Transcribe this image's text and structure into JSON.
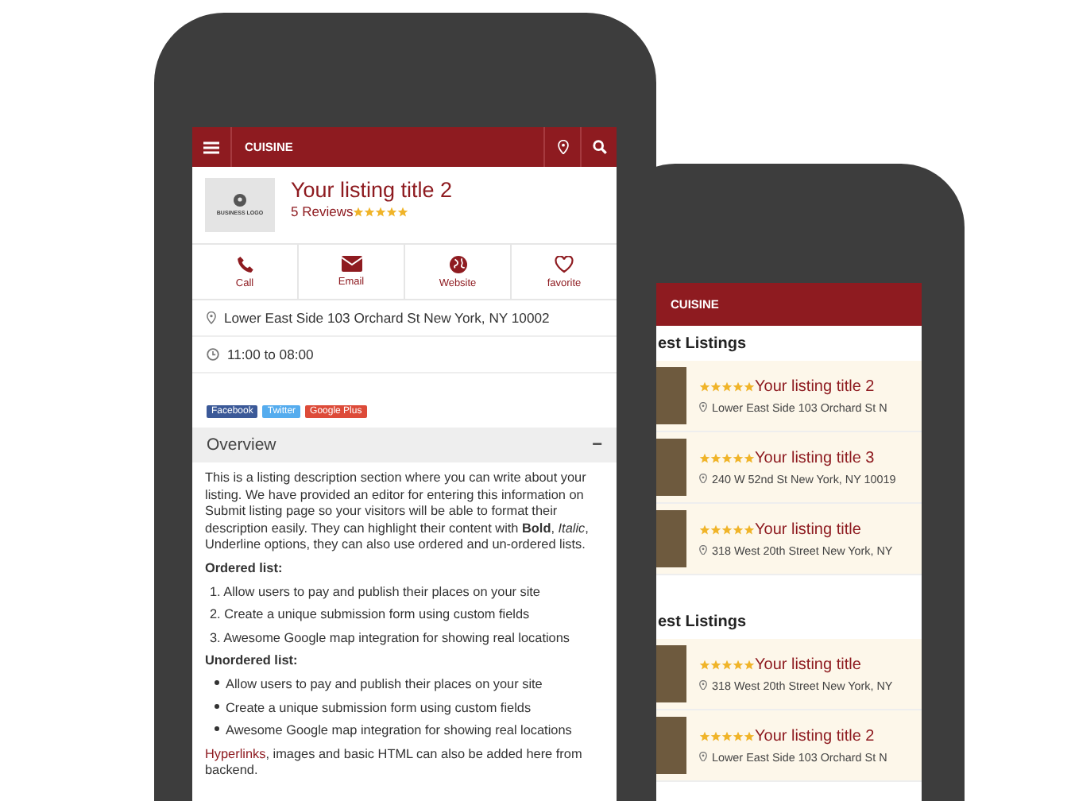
{
  "front_phone": {
    "header": {
      "title": "CUISINE"
    },
    "listing": {
      "logo_text": "BUSINESS LOGO",
      "title": "Your listing title 2",
      "reviews": "5 Reviews",
      "stars": 5
    },
    "actions": [
      {
        "kind": "phone",
        "label": "Call"
      },
      {
        "kind": "mail",
        "label": "Email"
      },
      {
        "kind": "globe",
        "label": "Website"
      },
      {
        "kind": "heart",
        "label": "favorite"
      }
    ],
    "address": "Lower East Side 103 Orchard St New York, NY 10002",
    "hours": "11:00 to 08:00",
    "share": [
      {
        "label": "Facebook",
        "color": "#3b5998"
      },
      {
        "label": "Twitter",
        "color": "#55acee"
      },
      {
        "label": "Google Plus",
        "color": "#dd4b39"
      }
    ],
    "overview": {
      "title": "Overview",
      "toggle": "−",
      "intro": "This is a listing description section where you can write about your listing. We have provided an editor for entering this information on Submit listing page so your visitors will be able to format their description easily. They can highlight their content with **Bold**, *Italic*, Underline options, they can also use ordered and un-ordered lists.",
      "ordered_heading": "Ordered list:",
      "ordered": [
        "1. Allow users to pay and publish their places on your site",
        "2. Create a unique submission form using custom fields",
        "3. Awesome Google map integration for showing real locations"
      ],
      "unordered_heading": "Unordered list:",
      "unordered": [
        "Allow users to pay and publish their places on your site",
        "Create a unique submission form using custom fields",
        "Awesome Google map integration for showing real locations"
      ],
      "closing_link": "Hyperlinks",
      "closing": ", images and basic HTML can also be added here from backend."
    }
  },
  "back_phone": {
    "header": {
      "title": "CUISINE"
    },
    "sections": [
      {
        "title": "est Listings",
        "items": [
          {
            "title": "Your listing title 2",
            "address": "Lower East Side 103 Orchard St N",
            "stars": 5
          },
          {
            "title": "Your listing title 3",
            "address": "240 W 52nd St New York, NY 10019",
            "stars": 5
          },
          {
            "title": "Your listing title",
            "address": "318 West 20th Street New York, NY",
            "stars": 5
          }
        ]
      },
      {
        "title": "est Listings",
        "items": [
          {
            "title": "Your listing title",
            "address": "318 West 20th Street New York, NY",
            "stars": 5
          },
          {
            "title": "Your listing title 2",
            "address": "Lower East Side 103 Orchard St N",
            "stars": 5
          }
        ]
      }
    ]
  }
}
